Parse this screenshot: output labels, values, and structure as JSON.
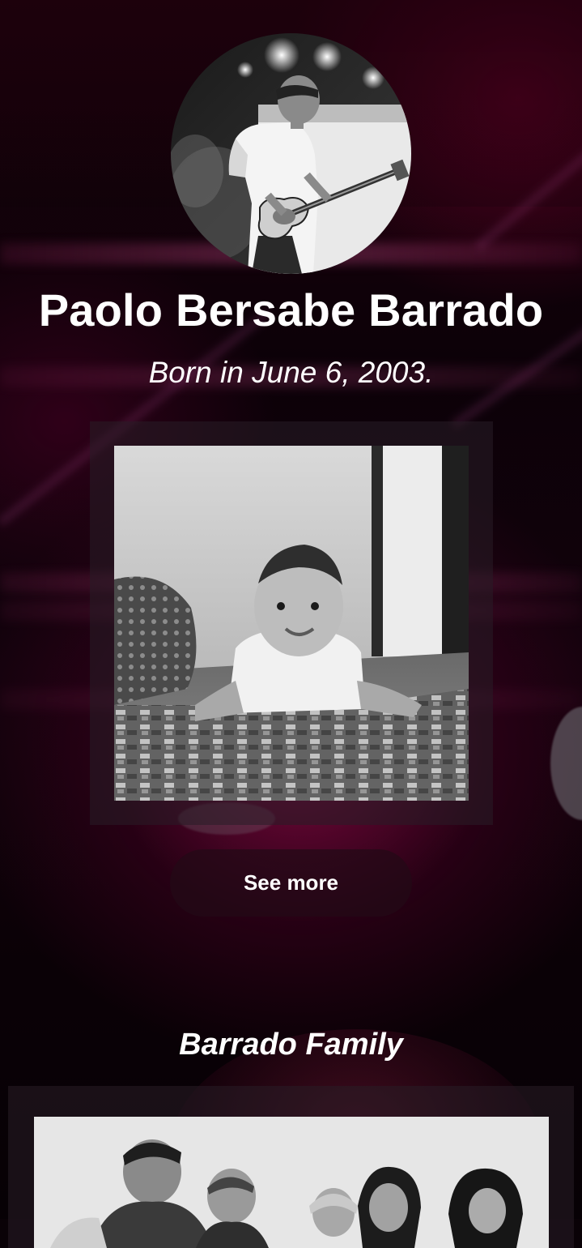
{
  "profile": {
    "name": "Paolo Bersabe Barrado",
    "birth_line": "Born in June 6, 2003."
  },
  "gallery": {
    "see_more_label": "See more"
  },
  "family_section": {
    "title": "Barrado Family"
  },
  "colors": {
    "accent_magenta": "#8c0a46",
    "background_dark": "#0a0207",
    "text": "#ffffff"
  }
}
